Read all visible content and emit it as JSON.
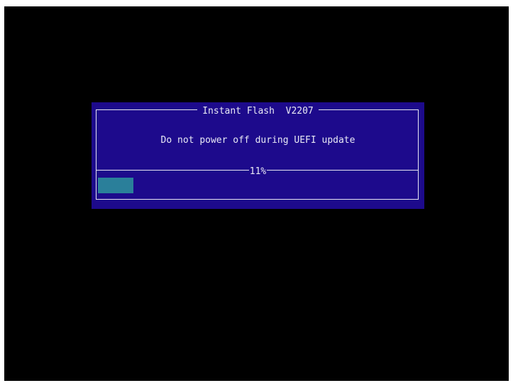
{
  "dialog": {
    "title": "Instant Flash  V2207",
    "message": "Do not power off during UEFI update",
    "progress_label": "11%",
    "progress_fraction": 0.11
  },
  "colors": {
    "screen_background": "#000000",
    "dialog_background": "#1d0a8c",
    "border": "#e6e6f2",
    "text": "#e8e8f4",
    "progress_fill": "#2a7f9a"
  }
}
